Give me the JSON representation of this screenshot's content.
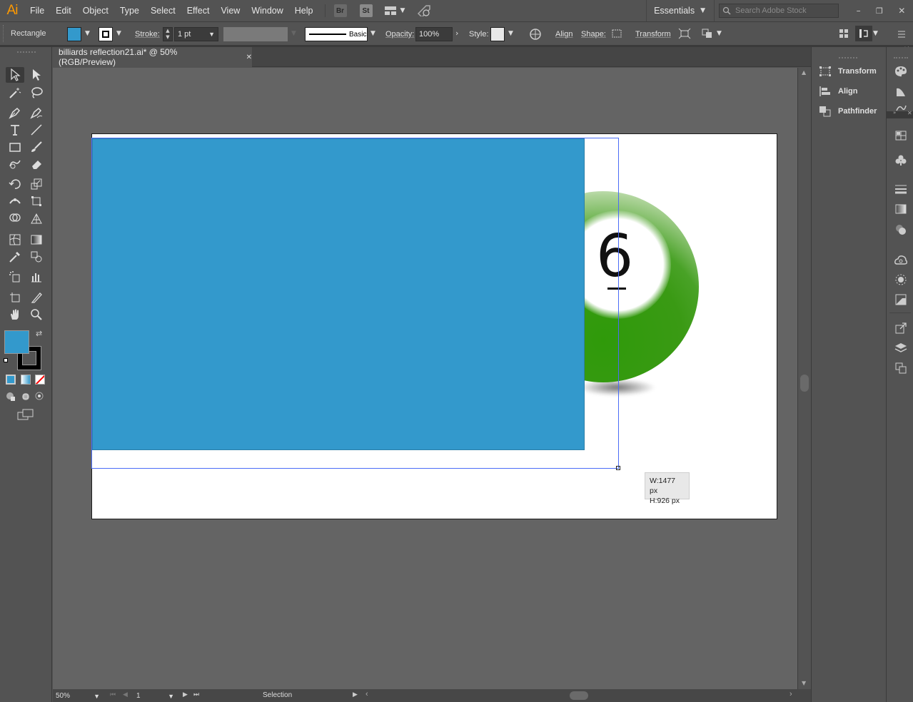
{
  "app": {
    "logo": "Ai"
  },
  "menu": {
    "items": [
      "File",
      "Edit",
      "Object",
      "Type",
      "Select",
      "Effect",
      "View",
      "Window",
      "Help"
    ]
  },
  "app_switch": {
    "bridge": "Br",
    "stock": "St"
  },
  "workspace": {
    "label": "Essentials",
    "search_placeholder": "Search Adobe Stock"
  },
  "control": {
    "selection_type": "Rectangle",
    "stroke_label": "Stroke:",
    "stroke_weight": "1 pt",
    "brush_label": "Basic",
    "opacity_label": "Opacity:",
    "opacity_value": "100%",
    "style_label": "Style:",
    "align_label": "Align",
    "shape_label": "Shape:",
    "transform_label": "Transform"
  },
  "document": {
    "tab_title": "billiards reflection21.ai* @ 50% (RGB/Preview)",
    "close_glyph": "✕"
  },
  "canvas": {
    "fill_color": "#3399cc",
    "ball_number": "6",
    "ball_color": "#3a9a14"
  },
  "measure": {
    "width": "W:1477 px",
    "height": "H:926 px"
  },
  "status": {
    "zoom": "50%",
    "artboard_number": "1",
    "tool_name": "Selection"
  },
  "right_panel": {
    "items": [
      "Transform",
      "Align",
      "Pathfinder"
    ]
  },
  "colors": {
    "fill": "#3399cc",
    "stroke": "#000000",
    "none": "#ff0000"
  }
}
